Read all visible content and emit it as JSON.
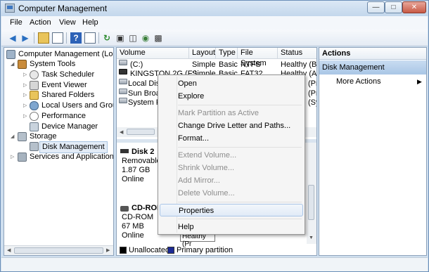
{
  "window": {
    "title": "Computer Management"
  },
  "menubar": {
    "items": [
      "File",
      "Action",
      "View",
      "Help"
    ]
  },
  "toolbar": {
    "icons": [
      "back-arrow-icon",
      "forward-arrow-icon",
      "up-folder-icon",
      "show-hide-tree-icon",
      "help-icon",
      "console-icon",
      "refresh-icon",
      "properties-icon",
      "export-icon",
      "disk-icon",
      "console2-icon"
    ]
  },
  "tree": {
    "root": "Computer Management (Local",
    "items": [
      {
        "label": "System Tools"
      },
      {
        "label": "Task Scheduler"
      },
      {
        "label": "Event Viewer"
      },
      {
        "label": "Shared Folders"
      },
      {
        "label": "Local Users and Groups"
      },
      {
        "label": "Performance"
      },
      {
        "label": "Device Manager"
      },
      {
        "label": "Storage"
      },
      {
        "label": "Disk Management"
      },
      {
        "label": "Services and Applications"
      }
    ]
  },
  "volumes": {
    "columns": [
      "Volume",
      "Layout",
      "Type",
      "File System",
      "Status"
    ],
    "rows": [
      {
        "volume": "(C:)",
        "layout": "Simple",
        "type": "Basic",
        "fs": "NTFS",
        "status": "Healthy (Bo"
      },
      {
        "volume": "KINGSTON 2G (F:)",
        "layout": "Simple",
        "type": "Basic",
        "fs": "FAT32",
        "status": "Healthy (Ac"
      },
      {
        "volume": "Local Disk",
        "layout": "",
        "type": "",
        "fs": "",
        "status": "(Pr"
      },
      {
        "volume": "Sun Broad",
        "layout": "",
        "type": "",
        "fs": "",
        "status": "(Pr"
      },
      {
        "volume": "System Re",
        "layout": "",
        "type": "",
        "fs": "",
        "status": "(Sy"
      }
    ]
  },
  "disks": [
    {
      "name": "Disk 2",
      "kind": "Removable",
      "size": "1.87 GB",
      "state": "Online"
    },
    {
      "name": "CD-ROM",
      "kind": "CD-ROM",
      "size": "67 MB",
      "state": "Online",
      "partition_status": "Healthy (Pr"
    }
  ],
  "legend": {
    "unallocated": "Unallocated",
    "primary": "Primary partition"
  },
  "actions": {
    "header": "Actions",
    "section": "Disk Management",
    "more": "More Actions"
  },
  "context_menu": {
    "open": "Open",
    "explore": "Explore",
    "mark_active": "Mark Partition as Active",
    "change_letter": "Change Drive Letter and Paths...",
    "format": "Format...",
    "extend": "Extend Volume...",
    "shrink": "Shrink Volume...",
    "add_mirror": "Add Mirror...",
    "delete": "Delete Volume...",
    "properties": "Properties",
    "help": "Help"
  },
  "colors": {
    "primary_partition": "#1c2a95",
    "unallocated": "#000000",
    "selection": "#a9c6e6"
  }
}
